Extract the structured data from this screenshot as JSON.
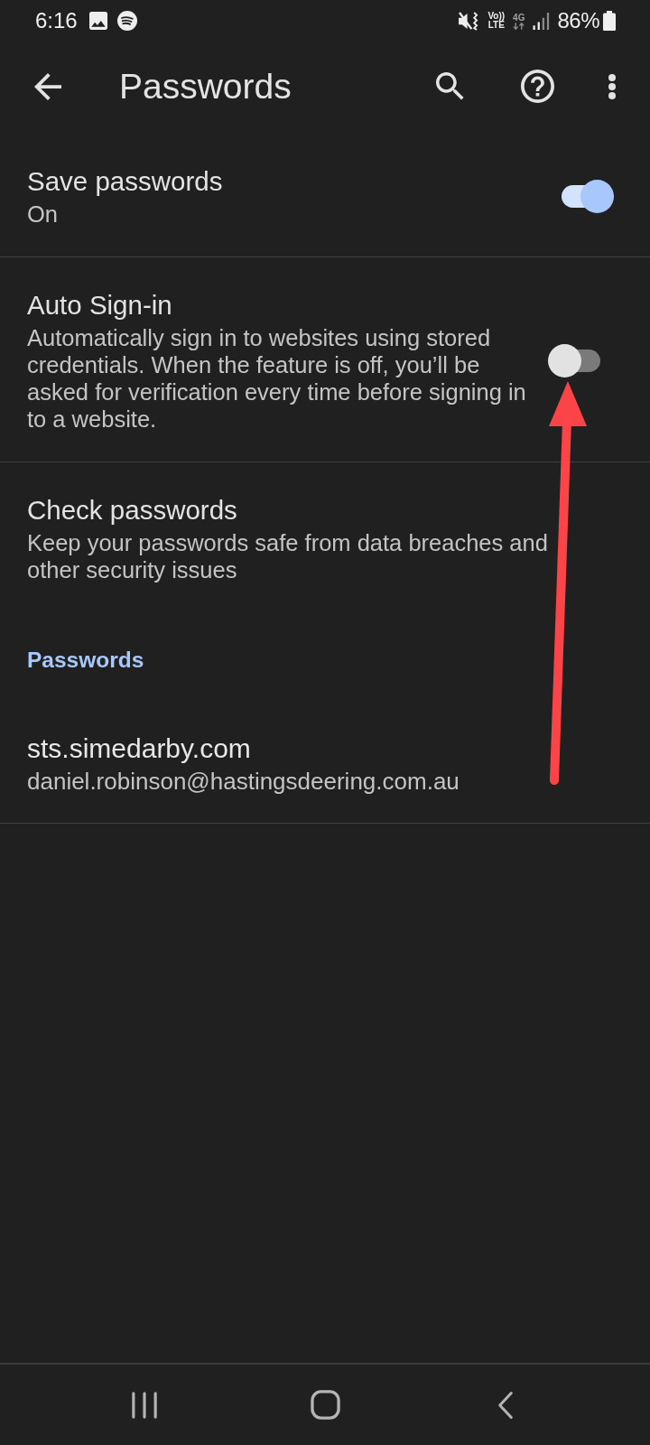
{
  "status_bar": {
    "time": "6:16",
    "volte": [
      "Vo))",
      "LTE"
    ],
    "network": "4G",
    "battery": "86%"
  },
  "toolbar": {
    "title": "Passwords"
  },
  "settings": [
    {
      "kind": "toggle",
      "title": "Save passwords",
      "subtitle": "On",
      "on": true
    },
    {
      "kind": "toggle",
      "title": "Auto Sign-in",
      "subtitle": "Automatically sign in to websites using stored credentials. When the feature is off, you’ll be asked for verification every time before signing in to a website.",
      "on": false
    },
    {
      "kind": "link",
      "title": "Check passwords",
      "subtitle": "Keep your passwords safe from data breaches and other security issues"
    }
  ],
  "saved_passwords": {
    "header": "Passwords",
    "entries": [
      {
        "site": "sts.simedarby.com",
        "username": "daniel.robinson@hastingsdeering.com.au"
      }
    ]
  }
}
